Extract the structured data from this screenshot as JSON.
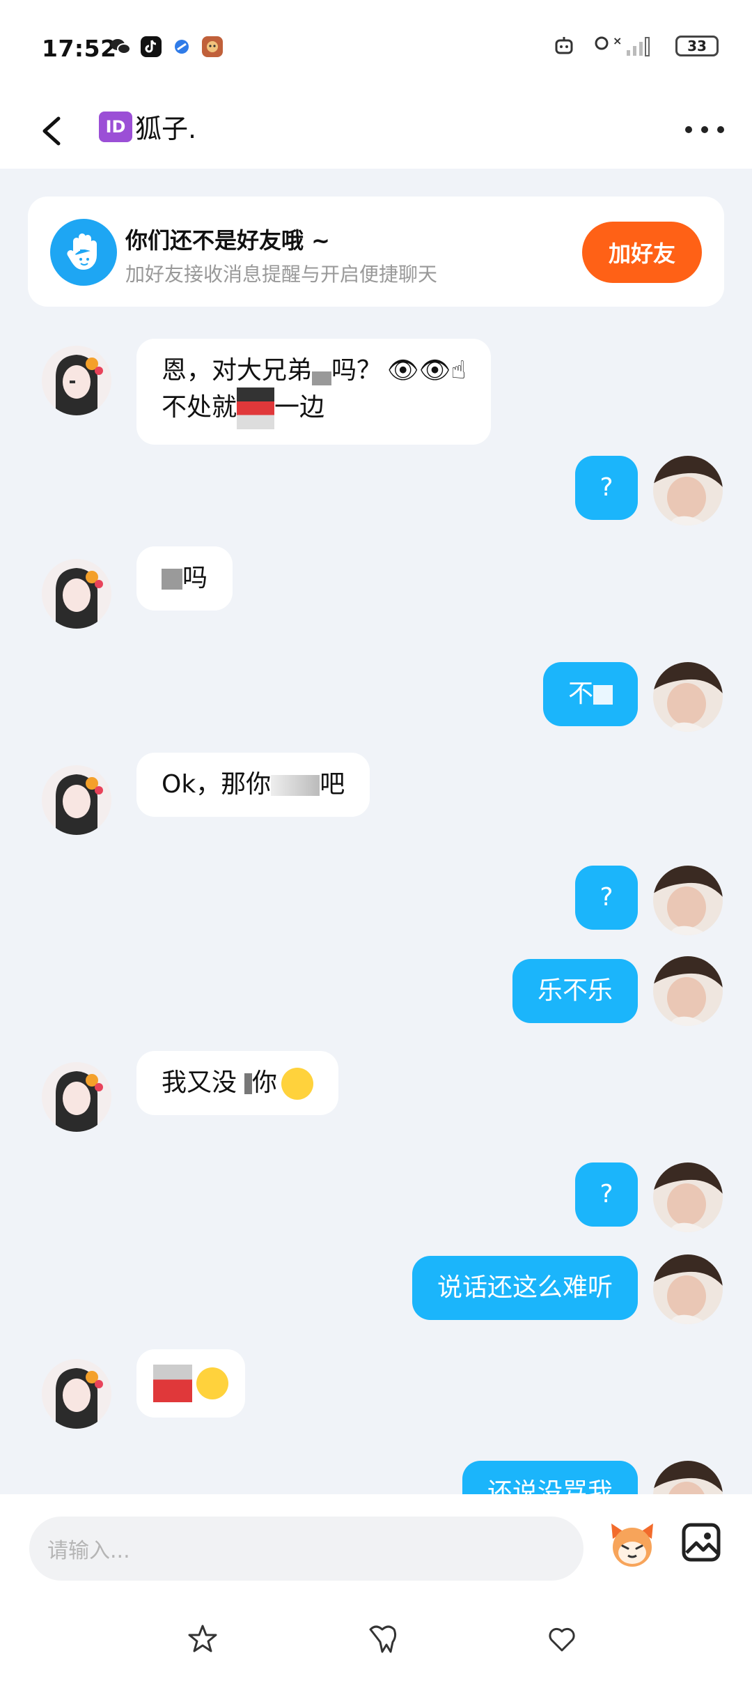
{
  "status_bar": {
    "time": "17:52",
    "apps": [
      "wechat-icon",
      "tiktok-icon",
      "browser-icon",
      "game-icon"
    ],
    "battery": "33"
  },
  "header": {
    "badge": "ID",
    "title": "狐子."
  },
  "notice": {
    "title": "你们还不是好友哦 ~",
    "subtitle": "加好友接收消息提醒与开启便捷聊天",
    "button": "加好友"
  },
  "messages": [
    {
      "side": "left",
      "lines": [
        "恩，对大兄弟",
        "吗？",
        "不处就",
        "一边"
      ]
    },
    {
      "side": "right",
      "text": "?"
    },
    {
      "side": "left",
      "text": "吗"
    },
    {
      "side": "right",
      "text": "不"
    },
    {
      "side": "left",
      "text_a": "Ok，那你",
      "text_b": "吧"
    },
    {
      "side": "right",
      "text": "?"
    },
    {
      "side": "right",
      "text": "乐不乐"
    },
    {
      "side": "left",
      "text_a": "我又没",
      "text_b": "你"
    },
    {
      "side": "right",
      "text": "?"
    },
    {
      "side": "right",
      "text": "说话还这么难听"
    },
    {
      "side": "left",
      "text": ""
    },
    {
      "side": "right",
      "text": "还说没骂我"
    }
  ],
  "input": {
    "placeholder": "请输入..."
  },
  "colors": {
    "accent_blue": "#1bb5fb",
    "add_friend_orange": "#ff6116",
    "background": "#f0f3f8"
  }
}
